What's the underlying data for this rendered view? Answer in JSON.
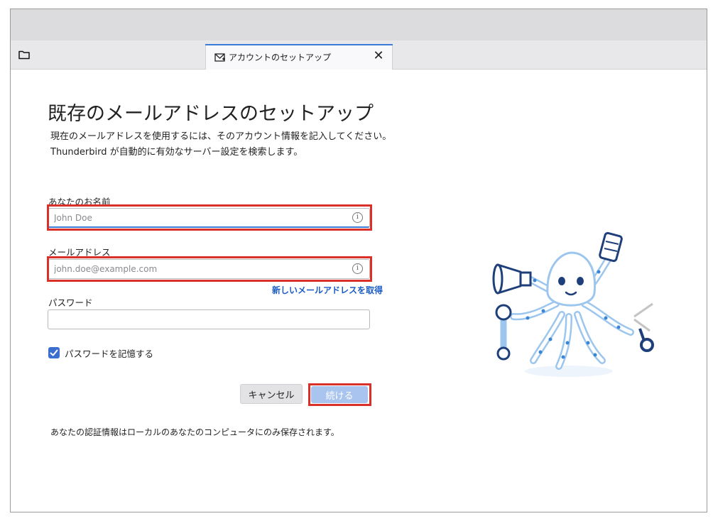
{
  "tab": {
    "title": "アカウントのセットアップ",
    "close_glyph": "✕"
  },
  "page": {
    "heading": "既存のメールアドレスのセットアップ",
    "description_line1": "現在のメールアドレスを使用するには、そのアカウント情報を記入してください。",
    "description_line2": "Thunderbird が自動的に有効なサーバー設定を検索します。"
  },
  "form": {
    "name_label": "あなたのお名前",
    "name_placeholder": "John Doe",
    "name_value": "",
    "email_label": "メールアドレス",
    "email_placeholder": "john.doe@example.com",
    "email_value": "",
    "new_email_link": "新しいメールアドレスを取得",
    "password_label": "パスワード",
    "password_value": "",
    "remember_label": "パスワードを記憶する",
    "remember_checked": true,
    "info_glyph": "i"
  },
  "buttons": {
    "cancel": "キャンセル",
    "continue": "続ける"
  },
  "footer": {
    "note": "あなたの認証情報はローカルのあなたのコンピュータにのみ保存されます。"
  },
  "icons": {
    "folder": "folder-icon",
    "tab": "mail-setup-icon",
    "close": "close-icon",
    "info": "info-icon",
    "check": "checkmark-icon",
    "mascot": "octopus-mascot-illustration"
  },
  "colors": {
    "accent": "#3a6fd0",
    "link": "#1a5bc6",
    "highlight": "#d9302a",
    "continue_button": "#a9c4ee"
  }
}
